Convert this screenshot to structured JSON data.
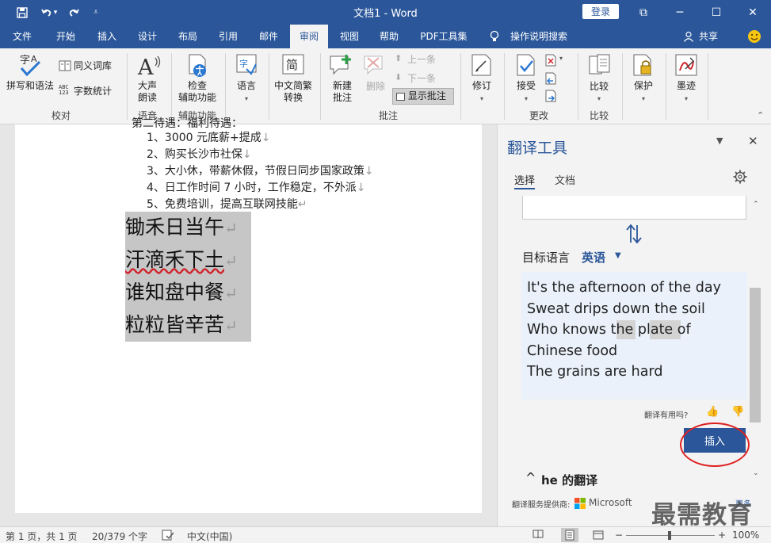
{
  "titlebar": {
    "doc_title": "文档1  -  Word",
    "login": "登录",
    "restore_icon": "⧉",
    "minimize_icon": "─",
    "maximize_icon": "☐",
    "close_icon": "✕"
  },
  "tabs": [
    {
      "label": "文件"
    },
    {
      "label": "开始"
    },
    {
      "label": "插入"
    },
    {
      "label": "设计"
    },
    {
      "label": "布局"
    },
    {
      "label": "引用"
    },
    {
      "label": "邮件"
    },
    {
      "label": "审阅"
    },
    {
      "label": "视图"
    },
    {
      "label": "帮助"
    },
    {
      "label": "PDF工具集"
    },
    {
      "label": "操作说明搜索"
    },
    {
      "label": "共享"
    }
  ],
  "ribbon": {
    "spelling": "拼写和语法",
    "thesaurus": "同义词库",
    "wordcount": "字数统计",
    "group_proofing": "校对",
    "readaloud": "大声\n朗读",
    "group_speech": "语音",
    "accessibility": "检查\n辅助功能",
    "group_accessibility": "辅助功能",
    "language": "语言",
    "chinese_conv": "中文简繁\n转换",
    "new_comment": "新建\n批注",
    "delete": "删除",
    "prev": "上一条",
    "next": "下一条",
    "show_comments": "显示批注",
    "group_comments": "批注",
    "track": "修订",
    "accept": "接受",
    "group_changes": "更改",
    "compare": "比较",
    "group_compare": "比较",
    "protect": "保护",
    "ink": "墨迹"
  },
  "document": {
    "clipped_line": "第二待遇：福利待遇：",
    "bullets": [
      "1、3000 元底薪+提成",
      "2、购买长沙市社保",
      "3、大小休，带薪休假，节假日同步国家政策",
      "4、日工作时间 7 小时，工作稳定，不外派",
      "5、免费培训，提高互联网技能"
    ],
    "poem": [
      "锄禾日当午",
      "汗滴禾下土",
      "谁知盘中餐",
      "粒粒皆辛苦"
    ]
  },
  "pane": {
    "title": "翻译工具",
    "tab_selection": "选择",
    "tab_document": "文档",
    "target_label": "目标语言",
    "target_lang": "英语",
    "result_lines": [
      "It's the afternoon of the day",
      "Sweat drips down the soil",
      "Who knows the plate of",
      "Chinese food",
      "The grains are hard"
    ],
    "feedback": "翻译有用吗?",
    "insert": "插入",
    "word_section": "he 的翻译",
    "provider": "翻译服务提供商:",
    "provider_name": "Microsoft",
    "more": "更多"
  },
  "status": {
    "page": "第 1 页，共 1 页",
    "words": "20/379 个字",
    "language": "中文(中国)",
    "zoom": "100%"
  },
  "watermark": "最需教育"
}
